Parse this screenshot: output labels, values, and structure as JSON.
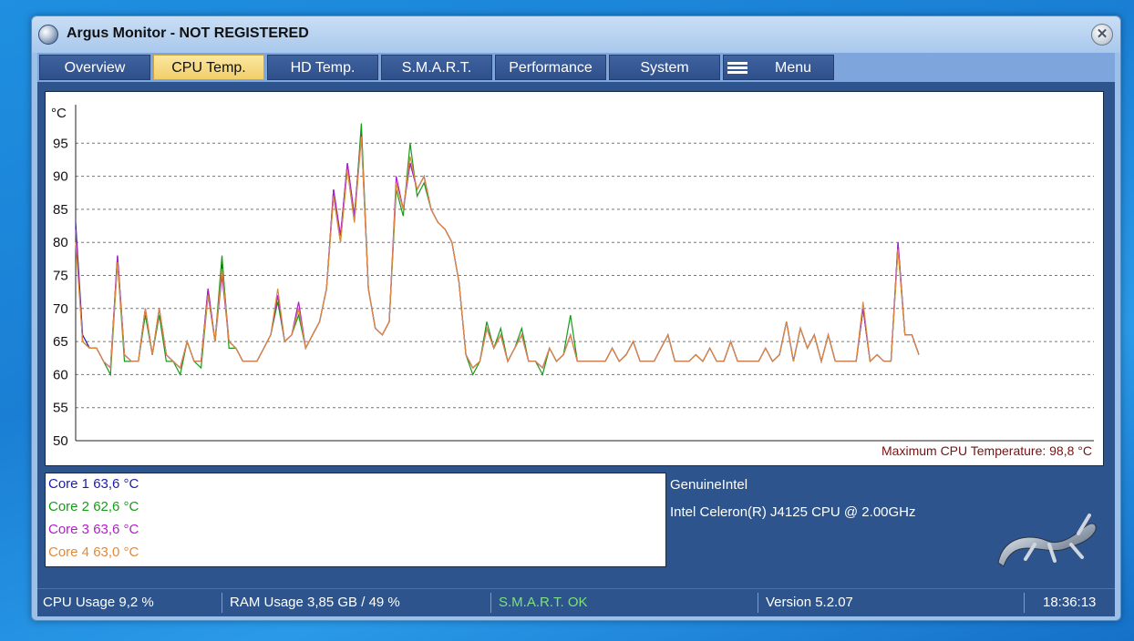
{
  "window": {
    "title": "Argus Monitor - NOT REGISTERED",
    "close_symbol": "✕"
  },
  "tabs": [
    {
      "label": "Overview",
      "active": false
    },
    {
      "label": "CPU Temp.",
      "active": true
    },
    {
      "label": "HD Temp.",
      "active": false
    },
    {
      "label": "S.M.A.R.T.",
      "active": false
    },
    {
      "label": "Performance",
      "active": false
    },
    {
      "label": "System",
      "active": false
    },
    {
      "label": "Menu",
      "active": false
    }
  ],
  "chart": {
    "unit_label": "°C",
    "max_label": "Maximum CPU Temperature: 98,8 °C"
  },
  "chart_data": {
    "type": "line",
    "ylabel": "°C",
    "ylim": [
      50,
      100
    ],
    "yticks": [
      50,
      55,
      60,
      65,
      70,
      75,
      80,
      85,
      90,
      95
    ],
    "grid": true,
    "series": [
      {
        "name": "Core 1",
        "color": "#1c1ca8",
        "values": [
          83,
          66,
          64,
          64,
          62,
          61,
          78,
          63,
          62,
          62,
          70,
          63,
          70,
          63,
          62,
          61,
          65,
          62,
          62,
          73,
          65,
          77,
          65,
          64,
          62,
          62,
          62,
          64,
          66,
          72,
          65,
          66,
          70,
          64,
          66,
          68,
          73,
          88,
          81,
          92,
          84,
          97,
          73,
          67,
          66,
          68,
          89,
          85,
          92,
          88,
          90,
          85,
          83,
          82,
          80,
          74,
          63,
          61,
          62,
          67,
          64,
          66,
          62,
          64,
          66,
          62,
          62,
          61,
          64,
          62,
          63,
          66,
          62,
          62,
          62,
          62,
          62,
          64,
          62,
          63,
          65,
          62,
          62,
          62,
          64,
          66,
          62,
          62,
          62,
          63,
          62,
          64,
          62,
          62,
          65,
          62,
          62,
          62,
          62,
          64,
          62,
          63,
          68,
          62,
          67,
          64,
          66,
          62,
          66,
          62,
          62,
          62,
          62,
          70,
          62,
          63,
          62,
          62,
          80,
          66,
          66,
          63
        ]
      },
      {
        "name": "Core 2",
        "color": "#1a9a1a",
        "values": [
          82,
          65,
          64,
          64,
          62,
          60,
          77,
          62,
          62,
          62,
          69,
          63,
          69,
          62,
          62,
          60,
          65,
          62,
          61,
          72,
          65,
          78,
          64,
          64,
          62,
          62,
          62,
          64,
          66,
          71,
          65,
          66,
          69,
          64,
          66,
          68,
          73,
          87,
          80,
          91,
          83,
          98,
          73,
          67,
          66,
          68,
          88,
          84,
          95,
          87,
          89,
          85,
          83,
          82,
          80,
          74,
          63,
          60,
          62,
          68,
          64,
          67,
          62,
          64,
          67,
          62,
          62,
          60,
          64,
          62,
          63,
          69,
          62,
          62,
          62,
          62,
          62,
          64,
          62,
          63,
          65,
          62,
          62,
          62,
          64,
          66,
          62,
          62,
          62,
          63,
          62,
          64,
          62,
          62,
          65,
          62,
          62,
          62,
          62,
          64,
          62,
          63,
          68,
          62,
          67,
          64,
          66,
          62,
          66,
          62,
          62,
          62,
          62,
          70,
          62,
          63,
          62,
          62,
          79,
          66,
          66,
          63
        ]
      },
      {
        "name": "Core 3",
        "color": "#b020c8",
        "values": [
          82,
          65,
          64,
          64,
          62,
          61,
          78,
          63,
          62,
          62,
          70,
          63,
          70,
          63,
          62,
          61,
          65,
          62,
          62,
          73,
          65,
          75,
          65,
          64,
          62,
          62,
          62,
          64,
          66,
          72,
          65,
          66,
          71,
          64,
          66,
          68,
          73,
          88,
          81,
          92,
          84,
          96,
          73,
          67,
          66,
          68,
          90,
          85,
          92,
          88,
          90,
          85,
          83,
          82,
          80,
          74,
          63,
          61,
          62,
          67,
          64,
          66,
          62,
          64,
          66,
          62,
          62,
          61,
          64,
          62,
          63,
          66,
          62,
          62,
          62,
          62,
          62,
          64,
          62,
          63,
          65,
          62,
          62,
          62,
          64,
          66,
          62,
          62,
          62,
          63,
          62,
          64,
          62,
          62,
          65,
          62,
          62,
          62,
          62,
          64,
          62,
          63,
          68,
          62,
          67,
          64,
          66,
          62,
          66,
          62,
          62,
          62,
          62,
          70,
          62,
          63,
          62,
          62,
          80,
          66,
          66,
          63
        ]
      },
      {
        "name": "Core 4",
        "color": "#e08a3a",
        "values": [
          80,
          65,
          64,
          64,
          62,
          61,
          77,
          63,
          62,
          62,
          70,
          63,
          70,
          63,
          62,
          61,
          65,
          62,
          62,
          72,
          65,
          76,
          65,
          64,
          62,
          62,
          62,
          64,
          66,
          73,
          65,
          66,
          70,
          64,
          66,
          68,
          73,
          87,
          80,
          91,
          83,
          96,
          73,
          67,
          66,
          68,
          89,
          85,
          93,
          88,
          90,
          85,
          83,
          82,
          80,
          74,
          63,
          61,
          62,
          67,
          64,
          66,
          62,
          64,
          66,
          62,
          62,
          61,
          64,
          62,
          63,
          66,
          62,
          62,
          62,
          62,
          62,
          64,
          62,
          63,
          65,
          62,
          62,
          62,
          64,
          66,
          62,
          62,
          62,
          63,
          62,
          64,
          62,
          62,
          65,
          62,
          62,
          62,
          62,
          64,
          62,
          63,
          68,
          62,
          67,
          64,
          66,
          62,
          66,
          62,
          62,
          62,
          62,
          71,
          62,
          63,
          62,
          62,
          79,
          66,
          66,
          63
        ]
      }
    ]
  },
  "legend": [
    {
      "text": "Core 1 63,6 °C",
      "color": "#1c1ca8"
    },
    {
      "text": "Core 2 62,6 °C",
      "color": "#1a9a1a"
    },
    {
      "text": "Core 3 63,6 °C",
      "color": "#b020c8"
    },
    {
      "text": "Core 4 63,0 °C",
      "color": "#e08a3a"
    }
  ],
  "cpu": {
    "vendor": "GenuineIntel",
    "model": "Intel Celeron(R) J4125 CPU @ 2.00GHz"
  },
  "status": {
    "cpu_usage": "CPU Usage 9,2 %",
    "ram_usage": "RAM Usage 3,85 GB / 49 %",
    "smart": "S.M.A.R.T. OK",
    "smart_color": "#7ee07e",
    "version": "Version 5.2.07",
    "time": "18:36:13"
  }
}
